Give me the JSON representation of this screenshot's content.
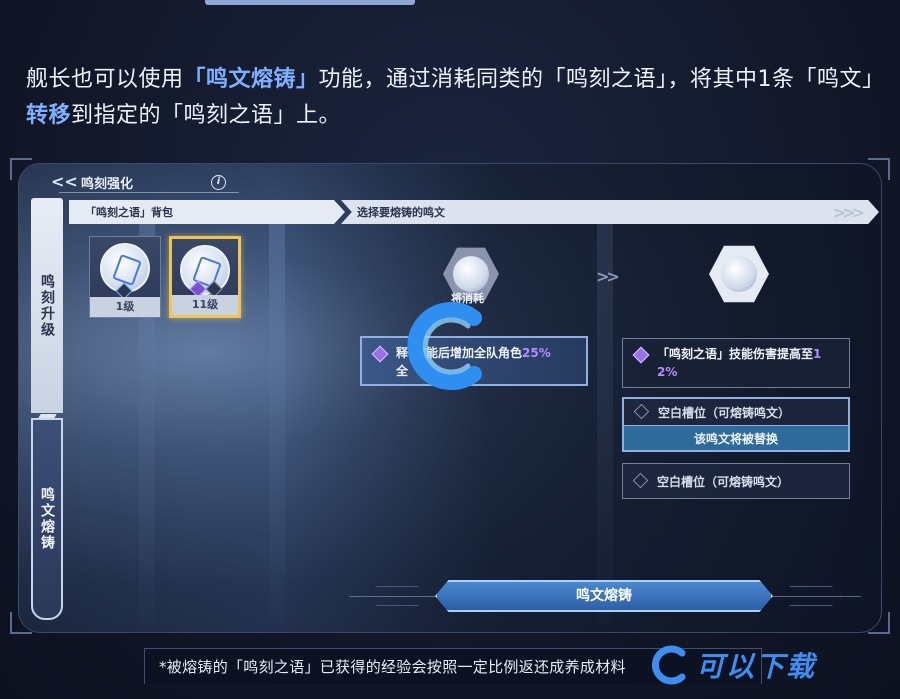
{
  "intro": {
    "part1": "舰长也可以使用",
    "highlight1": "「鸣文熔铸」",
    "part2": "功能，通过消耗同类的「鸣刻之语」，将其中1条「鸣文」",
    "highlight2": "转移",
    "part3": "到指定的「鸣刻之语」上。"
  },
  "header": {
    "back_icon": "back-chevrons-icon",
    "title": "鸣刻强化",
    "info_icon": "info-icon"
  },
  "side_tabs": [
    {
      "label": "鸣刻升级",
      "active": false
    },
    {
      "label": "鸣文熔铸",
      "active": true
    }
  ],
  "bars": {
    "left": "「鸣刻之语」背包",
    "right": "选择要熔铸的鸣文"
  },
  "inventory": [
    {
      "level": "1级",
      "selected": false
    },
    {
      "level": "11级",
      "selected": true
    }
  ],
  "consume": {
    "label": "将消耗",
    "effect_a": "释",
    "effect_b": "技能后增加全队角色",
    "effect_pct": "25%",
    "effect_c": "全"
  },
  "target": {
    "effect_text": "「鸣刻之语」技能伤害提高至",
    "effect_pct_a": "1",
    "effect_pct_b": "2%",
    "slot1": "空白槽位（可熔铸鸣文）",
    "slot1_note": "该鸣文将被替换",
    "slot2": "空白槽位（可熔铸鸣文）"
  },
  "forge_button": "鸣文熔铸",
  "footer_note": "*被熔铸的「鸣刻之语」已获得的经验会按照一定比例返还成养成材料",
  "watermark": "可以下载",
  "colors": {
    "accent": "#7fb0ff",
    "gold": "#f0c44e",
    "purple": "#b68cff",
    "button": "#2d5fa6"
  }
}
